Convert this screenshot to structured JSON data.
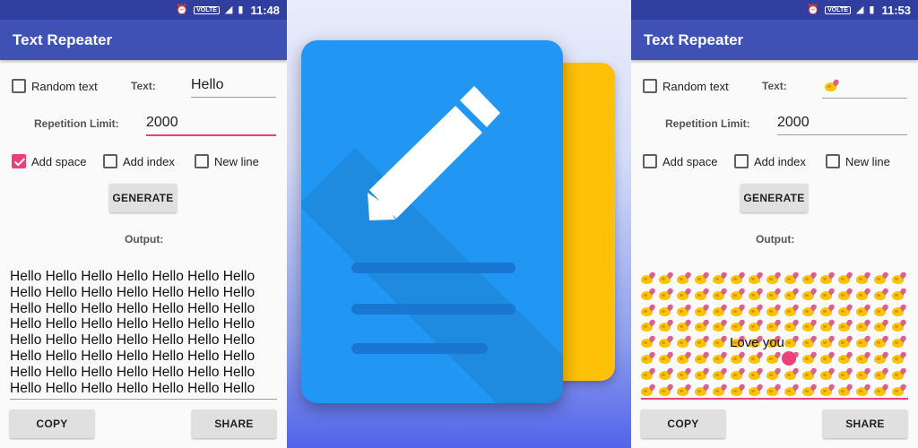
{
  "status_left": {
    "time": "11:48",
    "volte": "VOLTE"
  },
  "status_right": {
    "time": "11:53",
    "volte": "VOLTE"
  },
  "app": {
    "title": "Text Repeater"
  },
  "left_screen": {
    "random_text_label": "Random text",
    "text_label": "Text:",
    "text_value": "Hello",
    "repetition_label": "Repetition Limit:",
    "repetition_value": "2000",
    "add_space_label": "Add space",
    "add_space_checked": true,
    "add_index_label": "Add index",
    "new_line_label": "New line",
    "generate_label": "GENERATE",
    "output_label": "Output:",
    "output_lines": [
      "Hello Hello Hello Hello Hello Hello Hello",
      "Hello Hello Hello Hello Hello Hello Hello",
      "Hello Hello Hello Hello Hello Hello Hello",
      "Hello Hello Hello Hello Hello Hello Hello",
      "Hello Hello Hello Hello Hello Hello Hello",
      "Hello Hello Hello Hello Hello Hello Hello",
      "Hello Hello Hello Hello Hello Hello Hello",
      "Hello Hello Hello Hello Hello Hello Hello"
    ],
    "copy_label": "COPY",
    "share_label": "SHARE"
  },
  "right_screen": {
    "random_text_label": "Random text",
    "text_label": "Text:",
    "text_value_icon": "chick-heart-emoji",
    "repetition_label": "Repetition Limit:",
    "repetition_value": "2000",
    "add_space_label": "Add space",
    "add_index_label": "Add index",
    "new_line_label": "New line",
    "generate_label": "GENERATE",
    "output_label": "Output:",
    "output_emoji_icon": "chick-heart-emoji",
    "output_overlay_text": "Love you",
    "copy_label": "COPY",
    "share_label": "SHARE"
  },
  "colors": {
    "primary": "#3f51b5",
    "primary_dark": "#303f9f",
    "accent": "#ec407a",
    "logo_blue": "#2196f3",
    "logo_yellow": "#ffc107"
  }
}
